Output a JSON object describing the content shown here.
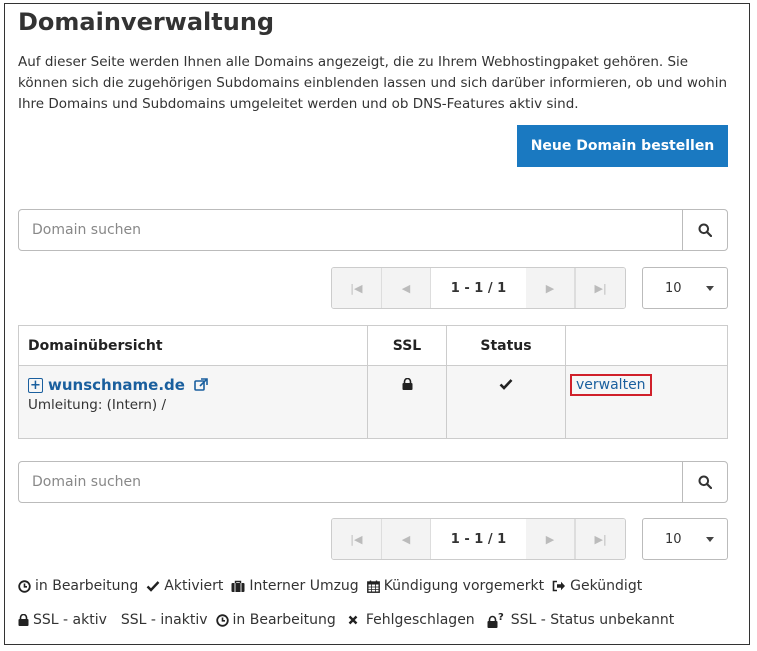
{
  "page": {
    "title": "Domainverwaltung",
    "intro": "Auf dieser Seite werden Ihnen alle Domains angezeigt, die zu Ihrem Webhostingpaket gehören. Sie können sich die zugehörigen Subdomains einblenden lassen und sich darüber informieren, ob und wohin Ihre Domains und Subdomains umgeleitet werden und ob DNS-Features aktiv sind.",
    "order_button": "Neue Domain bestellen"
  },
  "search": {
    "placeholder": "Domain suchen"
  },
  "pagination": {
    "info": "1 - 1 / 1",
    "per_page": "10"
  },
  "table": {
    "headers": {
      "overview": "Domainübersicht",
      "ssl": "SSL",
      "status": "Status"
    },
    "rows": [
      {
        "domain": "wunschname.de",
        "redirect": "Umleitung: (Intern) /",
        "manage": "verwalten"
      }
    ]
  },
  "legend_status": [
    {
      "icon": "clock-icon",
      "label": "in Bearbeitung"
    },
    {
      "icon": "check-icon",
      "label": "Aktiviert"
    },
    {
      "icon": "suitcase-icon",
      "label": "Interner Umzug"
    },
    {
      "icon": "calendar-icon",
      "label": "Kündigung vorgemerkt"
    },
    {
      "icon": "sign-out-icon",
      "label": "Gekündigt"
    }
  ],
  "legend_ssl": [
    {
      "icon": "lock-icon",
      "label": "SSL - aktiv"
    },
    {
      "icon": "",
      "label": "SSL - inaktiv"
    },
    {
      "icon": "clock-icon",
      "label": "in Bearbeitung"
    },
    {
      "icon": "times-icon",
      "label": "Fehlgeschlagen"
    },
    {
      "icon": "lock-question-icon",
      "label": "SSL - Status unbekannt"
    }
  ],
  "colors": {
    "primary": "#1a79c1",
    "link": "#1a5f9e",
    "highlight": "#d0202a"
  }
}
